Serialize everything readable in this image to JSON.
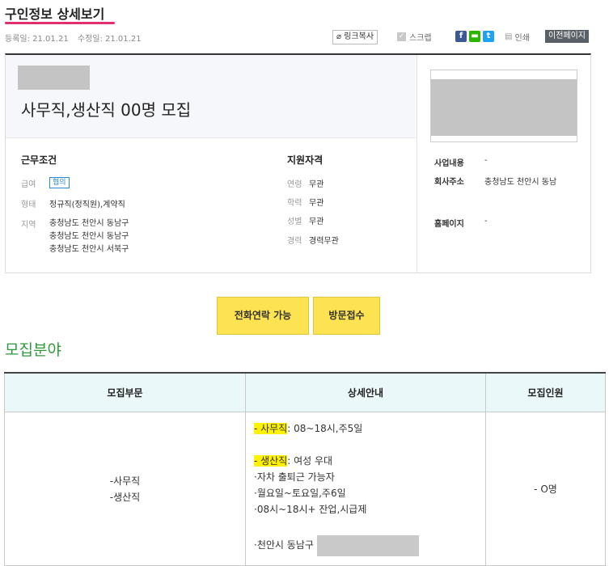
{
  "header": {
    "title": "구인정보 상세보기",
    "registered": "등록일: 21.01.21",
    "modified": "수정일: 21.01.21",
    "toolbar": {
      "link_copy": "링크복사",
      "scrap": "스크랩",
      "print": "인쇄",
      "prev_page": "이전페이지"
    }
  },
  "summary": {
    "job_title": "사무직,생산직 00명 모집",
    "work_conditions": {
      "heading": "근무조건",
      "salary_label": "급여",
      "salary_badge": "협의",
      "type_label": "형태",
      "type_value": "정규직(정직원),계약직",
      "region_label": "지역",
      "regions": [
        "충청남도 천안시 동남구",
        "충청남도 천안시 동남구",
        "충청남도 천안시 서북구"
      ]
    },
    "qualifications": {
      "heading": "지원자격",
      "age_label": "연령",
      "age_value": "무관",
      "education_label": "학력",
      "education_value": "무관",
      "gender_label": "성별",
      "gender_value": "무관",
      "career_label": "경력",
      "career_value": "경력무관"
    },
    "company": {
      "business_label": "사업내용",
      "business_value": "-",
      "address_label": "회사주소",
      "address_value": "충청남도 천안시 동남",
      "homepage_label": "홈페이지",
      "homepage_value": "-"
    }
  },
  "actions": {
    "phone": "전화연락 가능",
    "visit": "방문접수"
  },
  "recruit": {
    "section_title": "모집분야",
    "columns": [
      "모집부문",
      "상세안내",
      "모집인원"
    ],
    "row": {
      "departments": [
        "-사무직",
        "-생산직"
      ],
      "details": {
        "office_highlight": "- 사무직",
        "office_text": ": 08~18시,주5일",
        "production_highlight": "- 생산직",
        "production_text": ": 여성 우대",
        "lines": [
          "·자차 출퇴근 가능자",
          "·월요일~토요일,주6일",
          "·08시~18시+ 잔업,시급제"
        ],
        "location": "·천안시 동남구"
      },
      "headcount": "- O명"
    }
  },
  "colors": {
    "accent_pink": "#e0306a",
    "section_green": "#2e9a3c",
    "button_yellow": "#fde252",
    "highlight": "#fff200"
  }
}
